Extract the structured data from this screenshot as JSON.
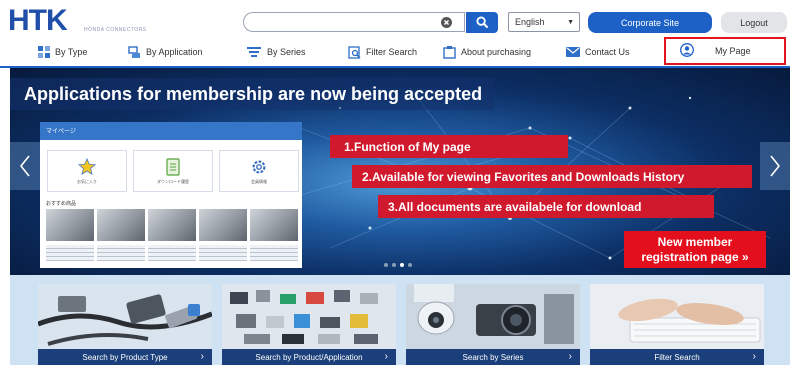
{
  "header": {
    "logo_text": "HTK",
    "logo_subtext": "HONDA CONNECTORS",
    "search": {
      "value": "",
      "placeholder": ""
    },
    "language": "English",
    "corporate_site_label": "Corporate Site",
    "logout_label": "Logout"
  },
  "nav": {
    "by_type": "By Type",
    "by_application": "By Application",
    "by_series": "By Series",
    "filter_search": "Filter Search",
    "about_purchasing": "About purchasing",
    "contact_us": "Contact Us",
    "my_page": "My Page"
  },
  "hero": {
    "title": "Applications for membership are now being accepted",
    "functions": [
      "1.Function of My page",
      "2.Available for viewing Favorites and Downloads History",
      "3.All documents are availabele for download"
    ],
    "register_line1": "New member",
    "register_line2": "registration page »",
    "mock": {
      "bar_title": "マイページ",
      "card1": "お気に入り",
      "card2": "ダウンロード履歴",
      "card3": "会員情報",
      "recommended": "おすすめ商品"
    }
  },
  "cards": [
    {
      "label": "Search by Product Type"
    },
    {
      "label": "Search by Product/Application"
    },
    {
      "label": "Search by Series"
    },
    {
      "label": "Filter Search"
    }
  ],
  "colors": {
    "brand": "#1d61c7",
    "accent_red": "#d1192e",
    "highlight_border": "#e3141c"
  }
}
